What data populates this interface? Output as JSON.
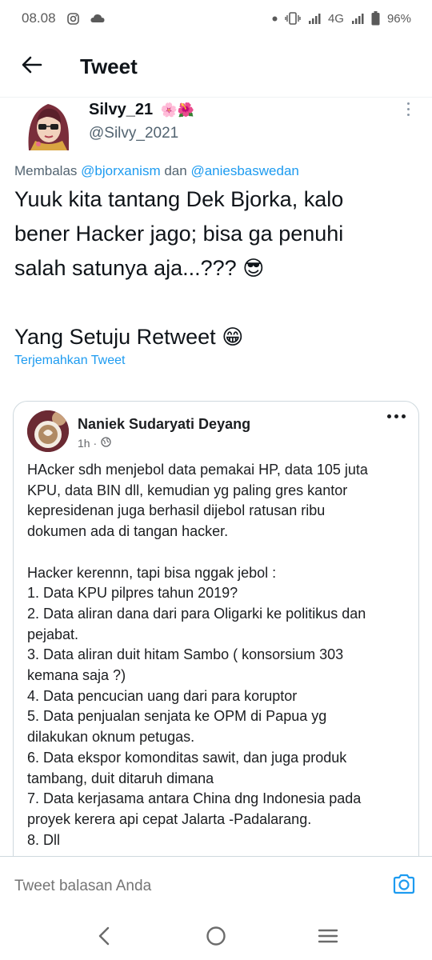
{
  "status_bar": {
    "time": "08.08",
    "network": "4G",
    "battery": "96%",
    "icons": [
      "instagram-icon",
      "cloud-icon",
      "dot-icon",
      "vibrate-icon",
      "signal-icon",
      "battery-icon"
    ]
  },
  "header": {
    "title": "Tweet",
    "back_icon": "arrow-left-icon"
  },
  "author": {
    "name": "Silvy_21",
    "name_emoji": "🌸🌺",
    "handle": "@Silvy_2021"
  },
  "reply": {
    "prefix": "Membalas",
    "mention1": "@bjorxanism",
    "connector": "dan",
    "mention2": "@aniesbaswedan"
  },
  "tweet": {
    "line1": "Yuuk kita tantang Dek Bjorka, kalo",
    "line2": "bener Hacker jago; bisa ga penuhi",
    "line3": "salah satunya aja...???",
    "line3_emoji": "😎",
    "line4": "Yang Setuju Retweet",
    "line4_emoji": "😁",
    "translate": "Terjemahkan Tweet"
  },
  "quoted_post": {
    "author": "Naniek Sudaryati Deyang",
    "time": "1h ·",
    "lines": [
      "HAcker sdh menjebol data pemakai HP, data 105 juta",
      "KPU, data BIN dll, kemudian yg paling  gres  kantor",
      "kepresidenan juga berhasil dijebol ratusan ribu",
      "dokumen ada di tangan hacker.",
      "",
      "Hacker kerennn, tapi bisa nggak  jebol :",
      "1. Data KPU pilpres tahun 2019?",
      "2. Data aliran dana dari para Oligarki ke politikus dan",
      "pejabat.",
      "3. Data aliran duit hitam Sambo ( konsorsium 303",
      "kemana saja ?)",
      "4. Data pencucian uang dari para koruptor",
      "5. Data penjualan senjata ke OPM di Papua yg",
      "dilakukan oknum petugas.",
      "6. Data ekspor komonditas sawit,  dan juga produk",
      "tambang, duit ditaruh dimana",
      "7. Data kerjasama antara China dng Indonesia pada",
      "proyek kerera api cepat Jalarta -Padalarang.",
      "8. Dll"
    ]
  },
  "reply_bar": {
    "placeholder": "Tweet balasan Anda",
    "camera_icon": "camera-icon"
  },
  "nav": {
    "back_icon": "nav-back-icon",
    "home_icon": "nav-home-icon",
    "recents_icon": "nav-recents-icon"
  },
  "colors": {
    "accent": "#1d9bf0",
    "text": "#0f1419",
    "secondary": "#536471",
    "border": "#cfd9de"
  }
}
